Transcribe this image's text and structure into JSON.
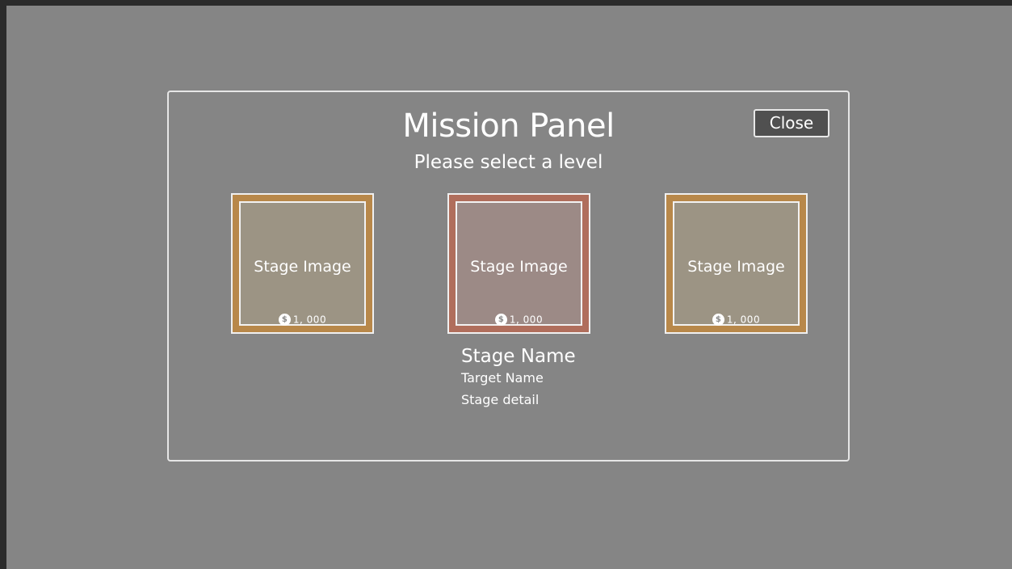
{
  "panel": {
    "title": "Mission Panel",
    "subtitle": "Please select a level",
    "close_label": "Close"
  },
  "stages": [
    {
      "image_label": "Stage Image",
      "cost": "1, 000",
      "coin_symbol": "$",
      "state": "normal",
      "frame_color": "#b8884a",
      "fill_color": "#9c9484"
    },
    {
      "image_label": "Stage Image",
      "cost": "1, 000",
      "coin_symbol": "$",
      "state": "selected",
      "frame_color": "#b06e5c",
      "fill_color": "#9c8a86"
    },
    {
      "image_label": "Stage Image",
      "cost": "1, 000",
      "coin_symbol": "$",
      "state": "normal",
      "frame_color": "#b8884a",
      "fill_color": "#9c9484"
    }
  ],
  "selected_stage": {
    "name": "Stage Name",
    "target": "Target Name",
    "detail": "Stage detail"
  },
  "colors": {
    "background": "#858585",
    "outer": "#2b2b2b",
    "text": "#ffffff",
    "close_button": "#505050"
  }
}
